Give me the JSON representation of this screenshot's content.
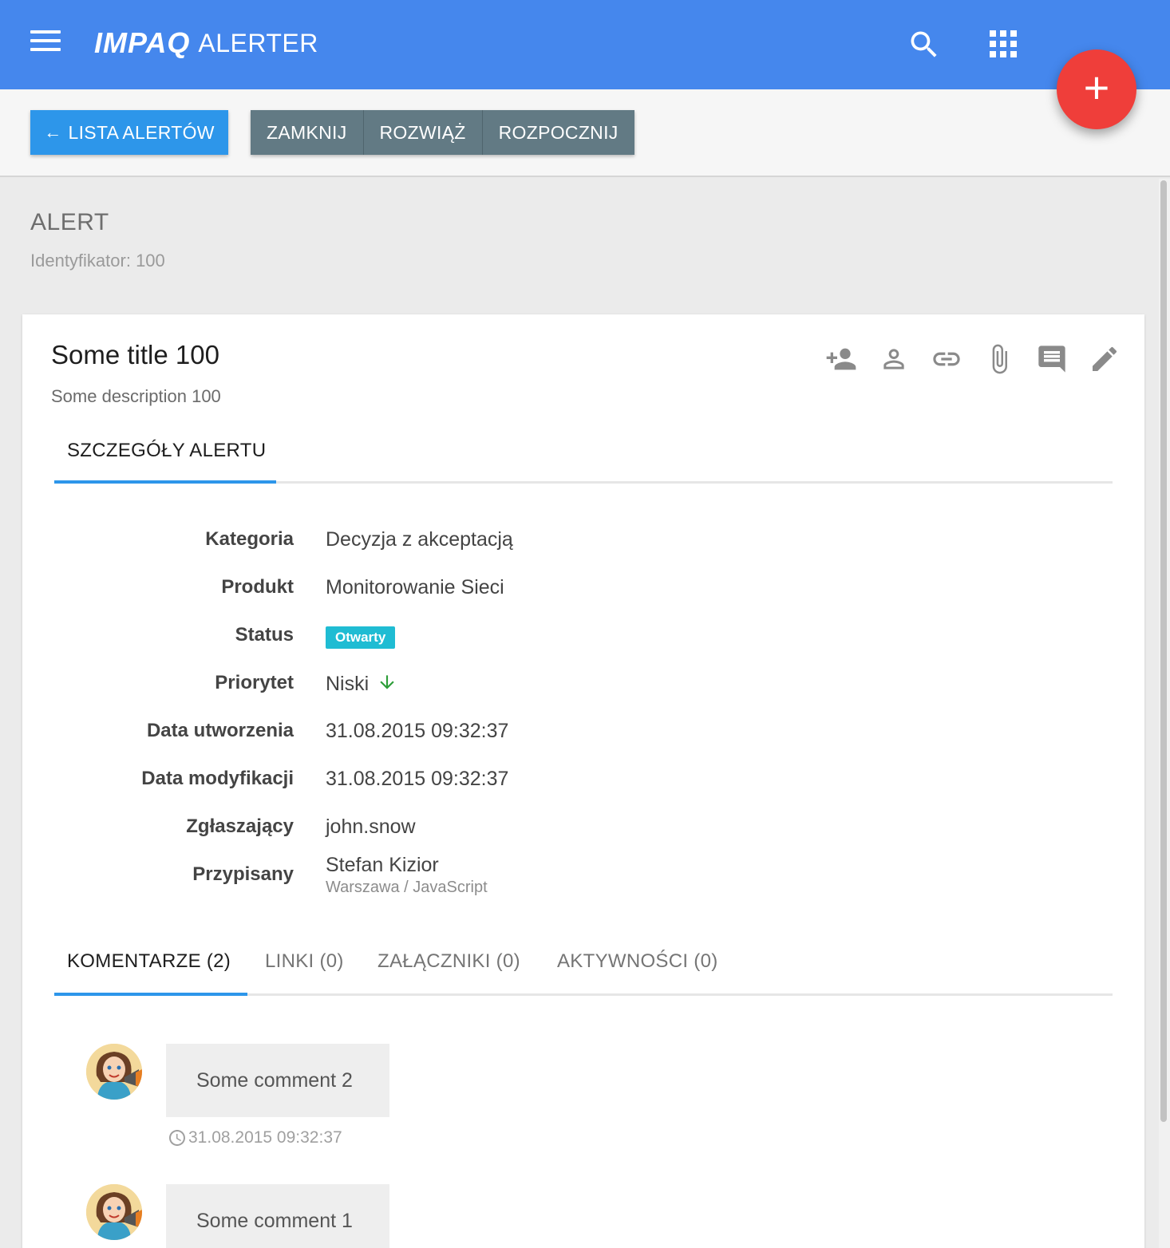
{
  "appbar": {
    "brand_logo": "IMPAQ",
    "brand_name": "ALERTER",
    "menu_icon": "hamburger-menu-icon",
    "search_icon": "search-icon",
    "apps_icon": "apps-grid-icon",
    "color": "#4587ed"
  },
  "fab": {
    "label": "+",
    "icon": "plus-icon",
    "color": "#ef3e3a"
  },
  "toolbar": {
    "back_label": "LISTA ALERTÓW",
    "back_icon": "arrow-left-icon",
    "actions": [
      "ZAMKNIJ",
      "ROZWIĄŻ",
      "ROZPOCZNIJ"
    ]
  },
  "header": {
    "title": "ALERT",
    "subtitle": "Identyfikator: 100"
  },
  "card": {
    "title": "Some title 100",
    "description": "Some description 100",
    "action_icons": [
      "add-person-icon",
      "person-icon",
      "link-icon",
      "attachment-icon",
      "comment-icon",
      "edit-pencil-icon"
    ],
    "details_tab": "SZCZEGÓŁY ALERTU",
    "fields": [
      {
        "label": "Kategoria",
        "value": "Decyzja z akceptacją"
      },
      {
        "label": "Produkt",
        "value": "Monitorowanie Sieci"
      },
      {
        "label": "Status",
        "value": "Otwarty"
      },
      {
        "label": "Priorytet",
        "value": "Niski"
      },
      {
        "label": "Data utworzenia",
        "value": "31.08.2015 09:32:37"
      },
      {
        "label": "Data modyfikacji",
        "value": "31.08.2015 09:32:37"
      },
      {
        "label": "Zgłaszający",
        "value": "john.snow"
      },
      {
        "label": "Przypisany",
        "value": "Stefan Kizior",
        "sub": "Warszawa / JavaScript"
      }
    ],
    "status_color": "#1fbcd3",
    "priority_icon": "arrow-down-icon",
    "priority_color": "#2e9e3a",
    "tabs": [
      "KOMENTARZE (2)",
      "LINKI (0)",
      "ZAŁĄCZNIKI (0)",
      "AKTYWNOŚCI (0)"
    ],
    "active_tab": "KOMENTARZE (2)",
    "accent": "#2d96ea",
    "comments": [
      {
        "text": "Some comment 2",
        "timestamp": "31.08.2015 09:32:37"
      },
      {
        "text": "Some comment 1"
      }
    ]
  }
}
